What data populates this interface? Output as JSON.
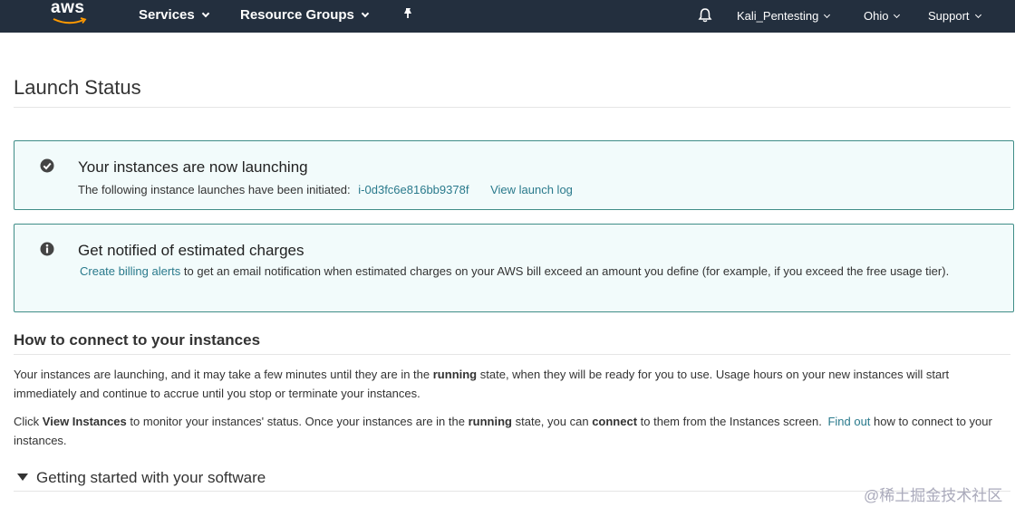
{
  "nav": {
    "logo_text": "aws",
    "services": "Services",
    "resource_groups": "Resource Groups",
    "account": "Kali_Pentesting",
    "region": "Ohio",
    "support": "Support",
    "header_bg": "#232f3e"
  },
  "page": {
    "title": "Launch Status"
  },
  "alert_launch": {
    "title": "Your instances are now launching",
    "body_prefix": "The following instance launches have been initiated:",
    "instance_id": "i-0d3fc6e816bb9378f",
    "view_log": "View launch log",
    "icon": "check-circle-icon"
  },
  "alert_billing": {
    "title": "Get notified of estimated charges",
    "link": "Create billing alerts",
    "body": "to get an email notification when estimated charges on your AWS bill exceed an amount you define (for example, if you exceed the free usage tier).",
    "icon": "info-icon"
  },
  "connect": {
    "title": "How to connect to your instances",
    "p1_a": "Your instances are launching, and it may take a few minutes until they are in the",
    "p1_b": "running",
    "p1_c": "state, when they will be ready for you to use. Usage hours on your new instances will start immediately and continue to accrue until you stop or terminate your instances.",
    "p2_a": "Click",
    "p2_b": "View Instances",
    "p2_c": "to monitor your instances' status. Once your instances are in the",
    "p2_d": "running",
    "p2_e": "state, you can",
    "p2_f": "connect",
    "p2_g": "to them from the Instances screen.",
    "p2_link": "Find out",
    "p2_h": "how to connect to your instances."
  },
  "getting_started": {
    "title": "Getting started with your software"
  },
  "watermark": "@稀土掘金技术社区",
  "colors": {
    "accent_link": "#2a7a8c",
    "alert_border": "#3f8d87",
    "alert_bg": "#f2fbfb"
  }
}
